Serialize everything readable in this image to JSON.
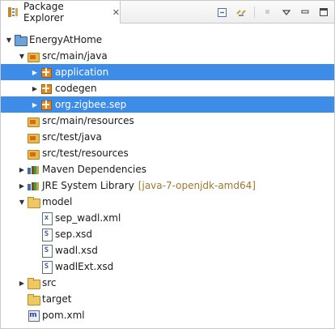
{
  "view": {
    "title": "Package Explorer",
    "close_glyph": "✕",
    "tab_icon": "package-explorer-icon",
    "toolbar": [
      "collapse-all-icon",
      "link-with-editor-icon",
      "focus-icon",
      "view-menu-icon",
      "minimize-icon",
      "maximize-icon"
    ]
  },
  "colors": {
    "selection": "#3c8ce8",
    "decoration": "#a0782c"
  },
  "tree": [
    {
      "label": "EnergyAtHome",
      "depth": 0,
      "twisty": "expanded",
      "icon": "project-icon"
    },
    {
      "label": "src/main/java",
      "depth": 1,
      "twisty": "expanded",
      "icon": "source-folder-icon"
    },
    {
      "label": "application",
      "depth": 2,
      "twisty": "collapsed",
      "icon": "package-icon",
      "selected": true
    },
    {
      "label": "codegen",
      "depth": 2,
      "twisty": "collapsed",
      "icon": "package-icon"
    },
    {
      "label": "org.zigbee.sep",
      "depth": 2,
      "twisty": "collapsed",
      "icon": "package-icon",
      "selected": true
    },
    {
      "label": "src/main/resources",
      "depth": 1,
      "twisty": "none",
      "icon": "source-folder-icon"
    },
    {
      "label": "src/test/java",
      "depth": 1,
      "twisty": "none",
      "icon": "source-folder-icon"
    },
    {
      "label": "src/test/resources",
      "depth": 1,
      "twisty": "none",
      "icon": "source-folder-icon"
    },
    {
      "label": "Maven Dependencies",
      "depth": 1,
      "twisty": "collapsed",
      "icon": "library-icon"
    },
    {
      "label": "JRE System Library",
      "decoration": "[java-7-openjdk-amd64]",
      "depth": 1,
      "twisty": "collapsed",
      "icon": "library-icon"
    },
    {
      "label": "model",
      "depth": 1,
      "twisty": "expanded",
      "icon": "folder-icon"
    },
    {
      "label": "sep_wadl.xml",
      "depth": 2,
      "twisty": "none",
      "icon": "xml-file-icon",
      "glyph": "x"
    },
    {
      "label": "sep.xsd",
      "depth": 2,
      "twisty": "none",
      "icon": "xsd-file-icon",
      "glyph": "S"
    },
    {
      "label": "wadl.xsd",
      "depth": 2,
      "twisty": "none",
      "icon": "xsd-file-icon",
      "glyph": "S"
    },
    {
      "label": "wadlExt.xsd",
      "depth": 2,
      "twisty": "none",
      "icon": "xsd-file-icon",
      "glyph": "S"
    },
    {
      "label": "src",
      "depth": 1,
      "twisty": "collapsed",
      "icon": "folder-icon"
    },
    {
      "label": "target",
      "depth": 1,
      "twisty": "none",
      "icon": "folder-icon"
    },
    {
      "label": "pom.xml",
      "depth": 1,
      "twisty": "none",
      "icon": "maven-pom-icon",
      "glyph": "m"
    }
  ]
}
